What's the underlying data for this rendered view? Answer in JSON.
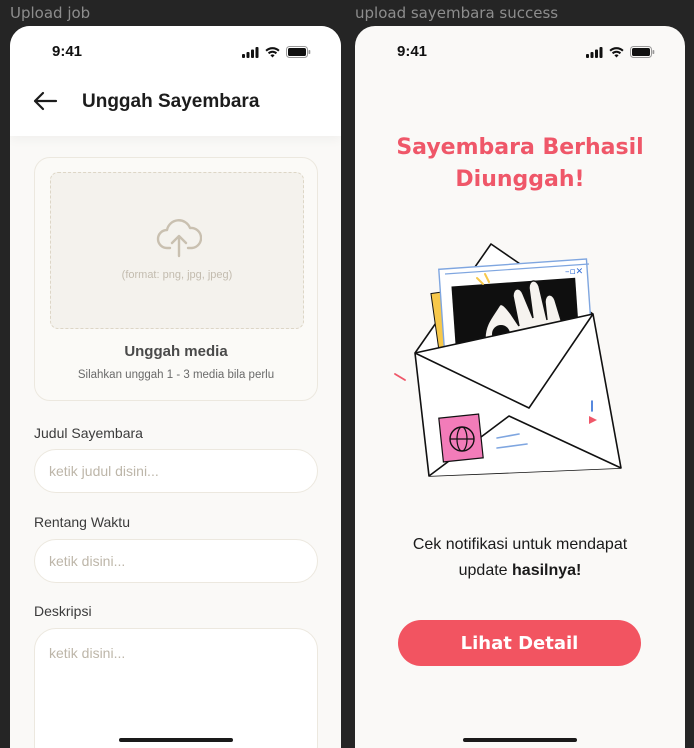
{
  "frames": {
    "left_label": "Upload job",
    "right_label": "upload sayembara success"
  },
  "status_bar": {
    "time": "9:41",
    "icons": [
      "signal-icon",
      "wifi-icon",
      "battery-icon"
    ]
  },
  "upload_screen": {
    "header_title": "Unggah Sayembara",
    "back_icon": "back-arrow-icon",
    "upload": {
      "icon": "cloud-upload-icon",
      "format_hint": "(format: png, jpg, jpeg)",
      "title": "Unggah media",
      "subtitle": "Silahkan unggah 1 - 3 media bila perlu"
    },
    "fields": [
      {
        "label": "Judul Sayembara",
        "placeholder": "ketik judul disini..."
      },
      {
        "label": "Rentang Waktu",
        "placeholder": "ketik disini..."
      },
      {
        "label": "Deskripsi",
        "placeholder": "ketik disini..."
      }
    ]
  },
  "success_screen": {
    "title_line1": "Sayembara Berhasil",
    "title_line2": "Diunggah!",
    "illustration": "envelope-photo-illustration",
    "notice_line1": "Cek notifikasi untuk mendapat",
    "notice_line2_prefix": "update ",
    "notice_line2_bold": "hasilnya!",
    "button_label": "Lihat Detail"
  },
  "colors": {
    "accent": "#ef5769",
    "button": "#f25461",
    "background": "#faf9f7",
    "canvas": "#252525"
  }
}
